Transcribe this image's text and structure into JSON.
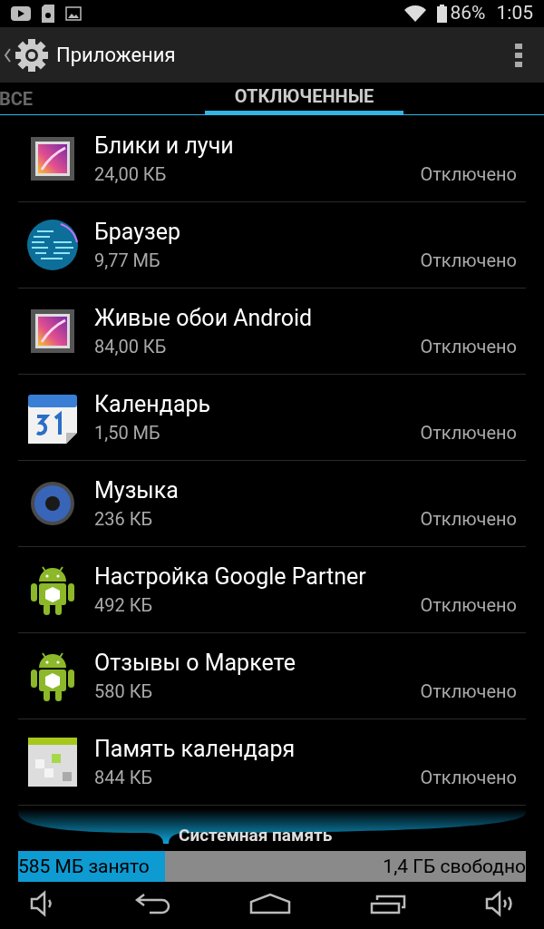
{
  "status_bar": {
    "battery": "86%",
    "time": "1:05"
  },
  "action_bar": {
    "title": "Приложения"
  },
  "tabs": [
    {
      "label": "ВСЕ",
      "selected": false
    },
    {
      "label": "ОТКЛЮЧЕННЫЕ",
      "selected": true
    }
  ],
  "apps": [
    {
      "name": "Блики и лучи",
      "size": "24,00 КБ",
      "status": "Отключено",
      "kind": "gallery"
    },
    {
      "name": "Браузер",
      "size": "9,77 МБ",
      "status": "Отключено",
      "kind": "globe"
    },
    {
      "name": "Живые обои Android",
      "size": "84,00 КБ",
      "status": "Отключено",
      "kind": "gallery"
    },
    {
      "name": "Календарь",
      "size": "1,50 МБ",
      "status": "Отключено",
      "kind": "calendar"
    },
    {
      "name": "Музыка",
      "size": "236 КБ",
      "status": "Отключено",
      "kind": "speaker"
    },
    {
      "name": "Настройка Google Partner",
      "size": "492 КБ",
      "status": "Отключено",
      "kind": "android"
    },
    {
      "name": "Отзывы о Маркете",
      "size": "580 КБ",
      "status": "Отключено",
      "kind": "android"
    },
    {
      "name": "Память календаря",
      "size": "844 КБ",
      "status": "Отключено",
      "kind": "grid"
    }
  ],
  "storage": {
    "title": "Системная память",
    "used": "585 МБ занято",
    "free": "1,4 ГБ свободно",
    "level": 0.29
  }
}
